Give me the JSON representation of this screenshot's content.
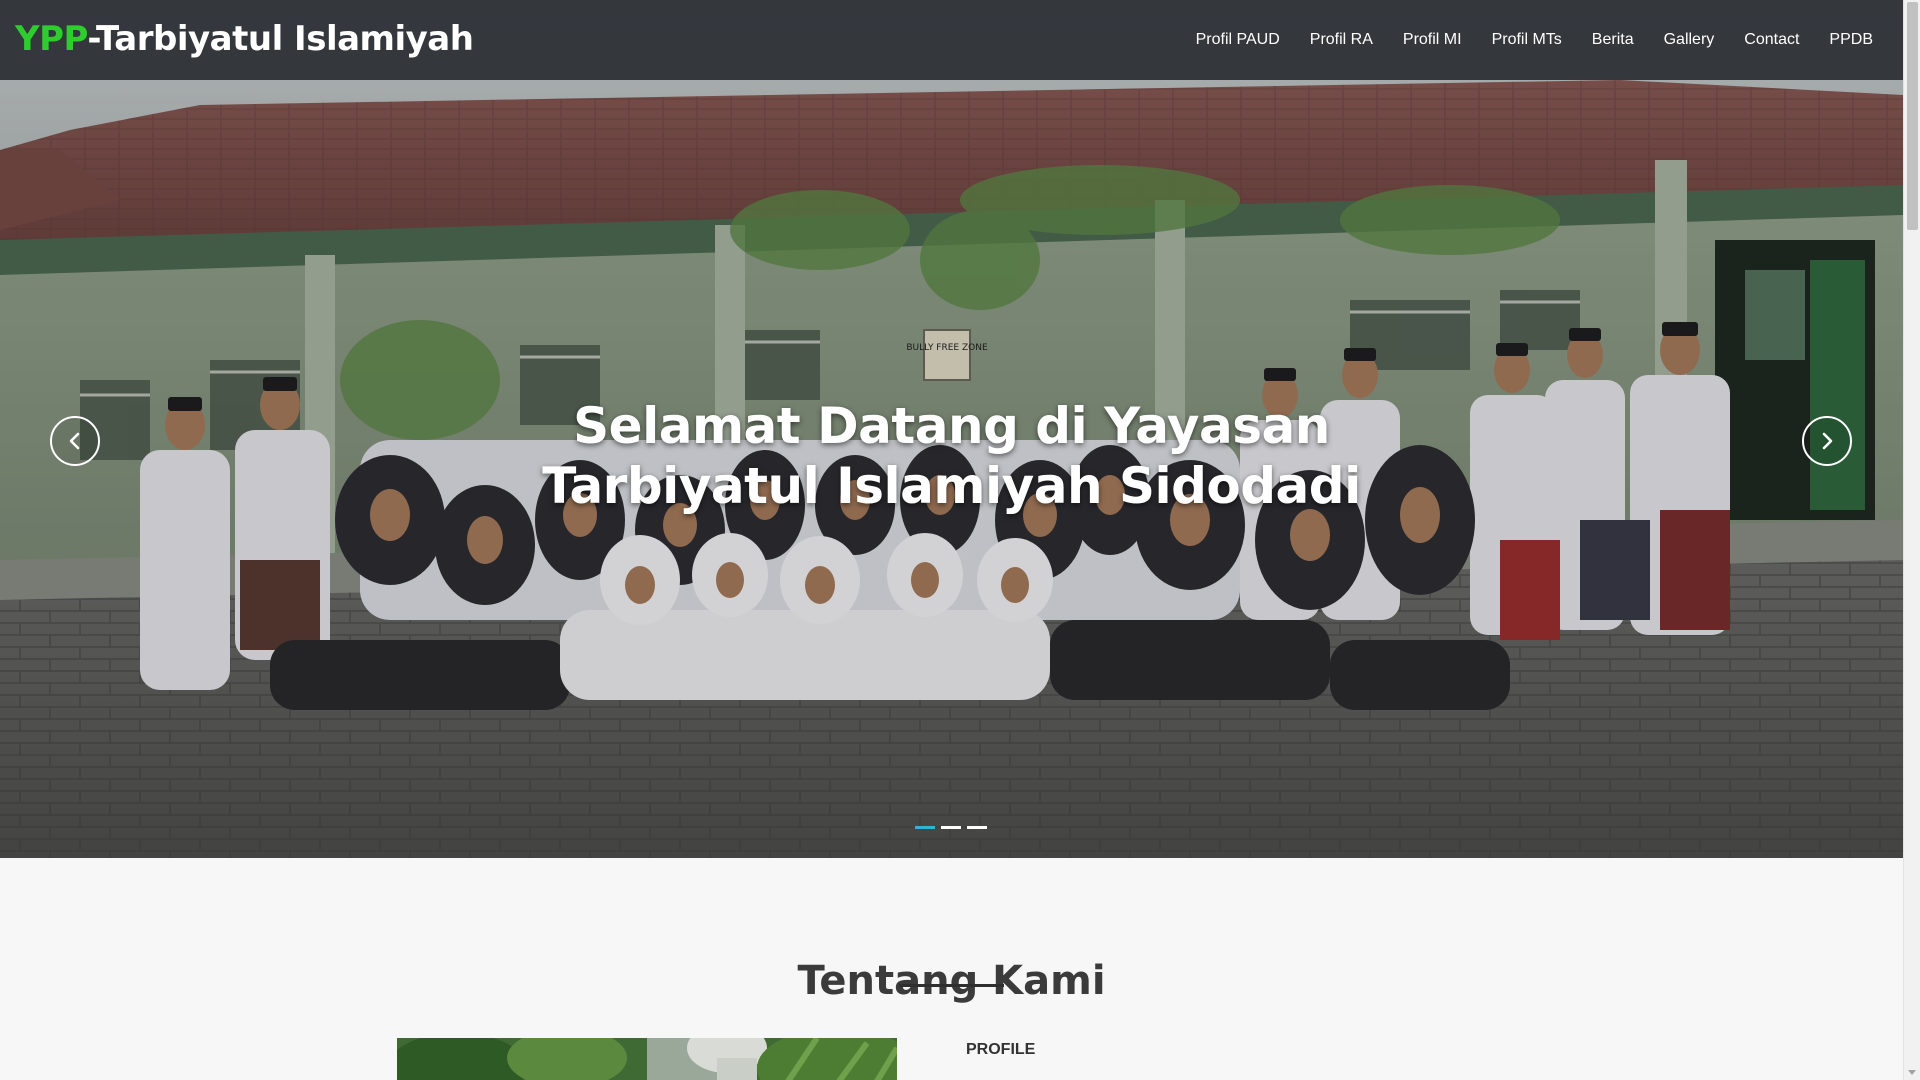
{
  "navbar": {
    "brand_accent": "YPP",
    "brand_rest": "-Tarbiyatul Islamiyah",
    "brand_accent_color": "#2ecc2e",
    "items": [
      {
        "label": "Profil PAUD"
      },
      {
        "label": "Profil RA"
      },
      {
        "label": "Profil MI"
      },
      {
        "label": "Profil MTs"
      },
      {
        "label": "Berita"
      },
      {
        "label": "Gallery"
      },
      {
        "label": "Contact"
      },
      {
        "label": "PPDB"
      }
    ]
  },
  "carousel": {
    "caption": "Selamat Datang di Yayasan Tarbiyatul Islamiyah Sidodadi",
    "sign_text": "BULLY FREE ZONE",
    "slide_count": 3,
    "active_slide": 1,
    "indicator_active_color": "#2bb6d6",
    "prev_icon": "chevron-left-icon",
    "next_icon": "chevron-right-icon"
  },
  "about": {
    "title": "Tentang Kami",
    "profile_label": "PROFILE"
  }
}
